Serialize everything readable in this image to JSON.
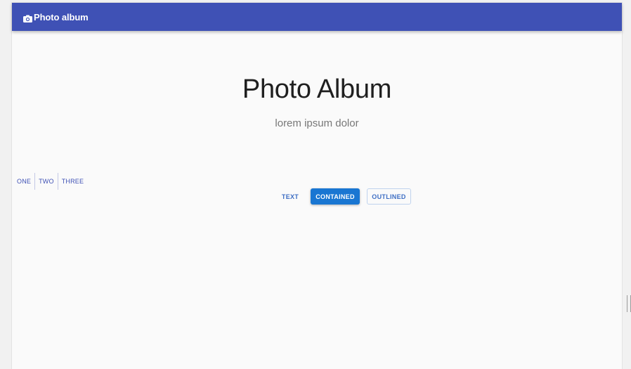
{
  "appbar": {
    "icon": "camera-icon",
    "title": "Photo album",
    "color": "#3f51b5"
  },
  "hero": {
    "title": "Photo Album",
    "subtitle": "lorem ipsum dolor"
  },
  "button_group": {
    "items": [
      {
        "label": "ONE"
      },
      {
        "label": "TWO"
      },
      {
        "label": "THREE"
      }
    ]
  },
  "buttons": {
    "text_label": "TEXT",
    "contained_label": "CONTAINED",
    "outlined_label": "OUTLINED",
    "primary_color": "#1976d2"
  }
}
